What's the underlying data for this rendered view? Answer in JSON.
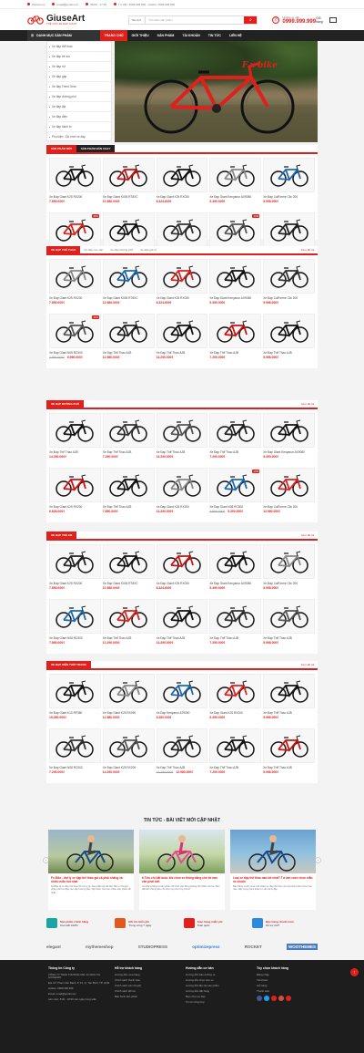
{
  "topbar": {
    "address": "Showroom",
    "email": "email@gmail.com",
    "hours": "08:00 - 17:30",
    "phones": "Tư Vấn: 0999.999.999 - Hotline: 0999.999.999"
  },
  "brand": {
    "name": "GiuseArt",
    "tagline": "THẾ GIỚI XE ĐẠP GIANT",
    "accent": "#e0201c"
  },
  "search": {
    "category": "Tất cả",
    "placeholder": "Tìm kiếm sản phẩm",
    "icon": "search-icon"
  },
  "hotline": {
    "label": "Hotline tư vấn",
    "number": "0999.999.999"
  },
  "cart": {
    "label": "Giỏ hàng"
  },
  "nav": {
    "categories_label": "DANH MỤC SẢN PHẨM",
    "items": [
      "TRANG CHỦ",
      "GIỚI THIỆU",
      "SẢN PHẨM",
      "TÀI KHOẢN",
      "TIN TỨC",
      "LIÊN HỆ"
    ]
  },
  "sidebar": [
    "Xe đạp thể thao",
    "Xe đạp trẻ em",
    "Xe đạp nữ",
    "Xe đạp gấp",
    "Xe đạp Fixed Gear",
    "Xe đạp đường phố",
    "Xe đạp địa",
    "Xe đạp điện",
    "Xe đạp bánh to",
    "Phụ kiện - Đồ chơi xe đạp"
  ],
  "banner": {
    "text": "F.x bike"
  },
  "sections": [
    {
      "tabs": [
        "SẢN PHẨM MỚI",
        "SẢN PHẨM BÁN CHẠY"
      ],
      "subs": [],
      "more": "",
      "products": [
        {
          "name": "Xe Đạp Giant K25 RX200",
          "price": "7.890.000₫",
          "old": ""
        },
        {
          "name": "Xe Đạp Giant K005 RT8XC",
          "price": "12.980.000₫",
          "old": ""
        },
        {
          "name": "Xe Đạp Giant K25 RX030",
          "price": "8.324.600₫",
          "old": ""
        },
        {
          "name": "Xe Đạp Giant Kenyarun AX9080",
          "price": "5.390.000₫",
          "old": ""
        },
        {
          "name": "Xe Đạp CalForme Clix 200",
          "price": "5.998.000₫",
          "old": ""
        },
        {
          "name": "Xe Đạp Giant N08 RC500",
          "price": "7.890.000₫",
          "old": "",
          "badge": "-20%"
        },
        {
          "name": "Xe Đạp Thể Thao AJB",
          "price": "12.980.000₫",
          "old": ""
        },
        {
          "name": "Xe Đạp Thể Thao AJB",
          "price": "14.290.000₫",
          "old": ""
        },
        {
          "name": "Xe Đạp Thể Thao AJB",
          "price": "7.290.000₫",
          "old": "",
          "badge": "-10%"
        },
        {
          "name": "Xe Đạp Thể Thao AJB",
          "price": "5.998.000₫",
          "old": ""
        }
      ]
    },
    {
      "tabs": [
        "XE ĐẠP THỂ THAO"
      ],
      "subs": [
        "Xe đạp cao cấp",
        "Xe đạp đường phố",
        "Xe đạp giá rẻ"
      ],
      "more": "Xem tất cả",
      "products": [
        {
          "name": "Xe Đạp Giant K25 RX200",
          "price": "7.890.000₫",
          "old": ""
        },
        {
          "name": "Xe Đạp Giant K005 RT8XC",
          "price": "12.980.000₫",
          "old": ""
        },
        {
          "name": "Xe Đạp Giant K25 RX030",
          "price": "8.324.600₫",
          "old": ""
        },
        {
          "name": "Xe Đạp Giant Kenyarun AX9080",
          "price": "5.390.000₫",
          "old": ""
        },
        {
          "name": "Xe Đạp CalForme Clix 200",
          "price": "5.998.000₫",
          "old": ""
        },
        {
          "name": "Xe Đạp Giant N08 RC500",
          "price": "6.990.000₫",
          "old": "7.890.000₫",
          "badge": "-11%"
        },
        {
          "name": "Xe Đạp Thể Thao AJB",
          "price": "12.980.000₫",
          "old": ""
        },
        {
          "name": "Xe Đạp Thể Thao AJB",
          "price": "14.290.000₫",
          "old": ""
        },
        {
          "name": "Xe Đạp Thể Thao AJB",
          "price": "7.290.000₫",
          "old": ""
        },
        {
          "name": "Xe Đạp Thể Thao AJB",
          "price": "5.998.000₫",
          "old": ""
        }
      ]
    },
    {
      "tabs": [
        "XE ĐẠP ĐƯỜNG PHỐ"
      ],
      "subs": [],
      "more": "Xem tất cả",
      "products": [
        {
          "name": "Xe Đạp Thể Thao AJB",
          "price": "14.290.000₫",
          "old": ""
        },
        {
          "name": "Xe Đạp Thể Thao AJB",
          "price": "7.290.000₫",
          "old": ""
        },
        {
          "name": "Xe Đạp Thể Thao AJB",
          "price": "14.290.000₫",
          "old": ""
        },
        {
          "name": "Xe Đạp Thể Thao AJB",
          "price": "7.290.000₫",
          "old": ""
        },
        {
          "name": "Xe Đạp Giant Kenyarun AX9080",
          "price": "5.390.000₫",
          "old": ""
        },
        {
          "name": "Xe Đạp Giant K25 RX200",
          "price": "6.826.000₫",
          "old": ""
        },
        {
          "name": "Xe Đạp Thể Thao AJB",
          "price": "7.890.000₫",
          "old": ""
        },
        {
          "name": "Xe Đạp Giant K25 RX200",
          "price": "14.290.000₫",
          "old": ""
        },
        {
          "name": "Xe Đạp Giant N08 RC500",
          "price": "5.390.000₫",
          "old": "6.990.000₫",
          "badge": "-23%"
        },
        {
          "name": "Xe Đạp CalForme Clix 200",
          "price": "12.980.000₫",
          "old": ""
        }
      ]
    },
    {
      "tabs": [
        "XE ĐẠP TRẺ EM"
      ],
      "subs": [],
      "more": "Xem tất cả",
      "products": [
        {
          "name": "Xe Đạp Giant K25 RX200",
          "price": "7.890.000₫",
          "old": ""
        },
        {
          "name": "Xe Đạp Giant K005 RT8XC",
          "price": "12.980.000₫",
          "old": ""
        },
        {
          "name": "Xe Đạp Giant K25 RX030",
          "price": "8.324.600₫",
          "old": ""
        },
        {
          "name": "Xe Đạp Giant Kenyarun AX9080",
          "price": "5.390.000₫",
          "old": ""
        },
        {
          "name": "Xe Đạp CalForme Clix 200",
          "price": "5.998.000₫",
          "old": ""
        },
        {
          "name": "Xe Đạp Giant N08 RC500",
          "price": "7.890.000₫",
          "old": ""
        },
        {
          "name": "Xe Đạp Thể Thao AJB",
          "price": "12.290.000₫",
          "old": ""
        },
        {
          "name": "Xe Đạp Thể Thao AJB",
          "price": "14.290.000₫",
          "old": ""
        },
        {
          "name": "Xe Đạp Thể Thao AJB",
          "price": "7.290.000₫",
          "old": ""
        },
        {
          "name": "Xe Đạp Thể Thao AJB",
          "price": "5.998.000₫",
          "old": ""
        }
      ]
    },
    {
      "tabs": [
        "XE ĐẠP HIỆN THỜI TRANG"
      ],
      "subs": [],
      "more": "Xem tất cả",
      "products": [
        {
          "name": "Xe Đạp Giant K10 RP380",
          "price": "15.260.000₫",
          "old": ""
        },
        {
          "name": "Xe Đạp Giant K25 RX090",
          "price": "12.980.000₫",
          "old": ""
        },
        {
          "name": "Xe Đạp Kenyarun AT9090",
          "price": "8.260.000₫",
          "old": ""
        },
        {
          "name": "Xe Đạp Giant K25 RX200",
          "price": "5.390.000₫",
          "old": ""
        },
        {
          "name": "Xe Đạp Thể Thao AJB",
          "price": "5.998.000₫",
          "old": ""
        },
        {
          "name": "Xe Đạp Giant N08 RC500",
          "price": "7.290.000₫",
          "old": ""
        },
        {
          "name": "Xe Đạp Giant K25 RX200",
          "price": "14.290.000₫",
          "old": ""
        },
        {
          "name": "Xe Đạp Thể Thao AJB",
          "price": "12.980.000₫",
          "old": "14.290.000₫"
        },
        {
          "name": "Xe Đạp Thể Thao AJB",
          "price": "7.290.000₫",
          "old": ""
        },
        {
          "name": "Xe Đạp Thể Thao AJB",
          "price": "5.998.000₫",
          "old": ""
        }
      ]
    }
  ],
  "news": {
    "title": "TIN TỨC - BÀI VIẾT MỚI CẬP NHẬT",
    "items": [
      {
        "title": "Fx Bike - đại lý xe đạp thể thao giá cả phải chăng và nhiều mẫu hot nhất",
        "desc": "FixBike là xe đạp thể thao tốt và uy tín hàng đầu tại Hà Nội. Bên e chuyên phân phối xe đạp cao cấp hương dẫn, tiếp kiệm cho bạn nhiều sản phẩm tốt nhất."
      },
      {
        "title": "6 Tiêu chí bắt buộc khi chọn xe thăng bằng cho bé bạn cần phải biết",
        "desc": "Xe thăng bằng là sản phẩm đồ chơi vận động không thể thiếu cho bé. Bạn đã biết những tiêu chí chọn xe phù hợp chưa?"
      },
      {
        "title": "Loại xe đạp thể thao nào tốt nhất? Tư vấn cách chọn mẫu xe chuẩn",
        "desc": "Bạn đang muốn mua một chiếc xe đạp thể thao nhưng không biết chọn loại nào. Hãy cùng tham khảo tư vấn dưới đây."
      }
    ]
  },
  "policies": [
    {
      "title": "Sản phẩm chính hãng",
      "desc": "Cam kết 100%"
    },
    {
      "title": "Đổi trả miễn phí",
      "desc": "Trong vòng 7 ngày"
    },
    {
      "title": "Giao hàng miễn phí",
      "desc": "Toàn quốc"
    },
    {
      "title": "Bảo hàng, thanh toán",
      "desc": "Hỗ trợ 24/7"
    }
  ],
  "brands": [
    "elegant",
    "mythemeshop",
    "STUDIOPRESS",
    "optimizepress",
    "ROCKET",
    "WOOTHEMES"
  ],
  "footer": {
    "cols": [
      {
        "title": "Thông tin Công ty",
        "lines": [
          "CÔNG TY TNHH THƯƠNG MẠI VÀ DỊCH VỤ GIUSEART",
          "Địa chỉ: Phạm Văn Bạch, P. 15, Q. Tân Bình, TP. HCM",
          "Hotline: 0999.999.999",
          "Email: email@gmail.com",
          "Làm việc: 8:00 - 18:00 các ngày trong tuần"
        ]
      },
      {
        "title": "Hỗ trợ khách hàng",
        "lines": [
          "Hướng dẫn mua hàng",
          "Chính sách thanh toán",
          "Chính sách vận chuyển",
          "Chính sách đổi trả",
          "Bảo hành sản phẩm"
        ]
      },
      {
        "title": "Hướng dẫn cơ bản",
        "lines": [
          "Hướng dẫn bảo dưỡng xe",
          "Hướng dẫn chọn size xe",
          "Hướng dẫn lắp ráp sản phẩm",
          "Hướng dẫn đặt hàng",
          "Mẹo chọn xe đạp",
          "Tin tức tổng hợp"
        ]
      },
      {
        "title": "Tùy chọn khách hàng",
        "lines": [
          "Đăng nhập",
          "Tài khoản",
          "Giỏ hàng",
          "Thanh toán"
        ]
      }
    ]
  }
}
